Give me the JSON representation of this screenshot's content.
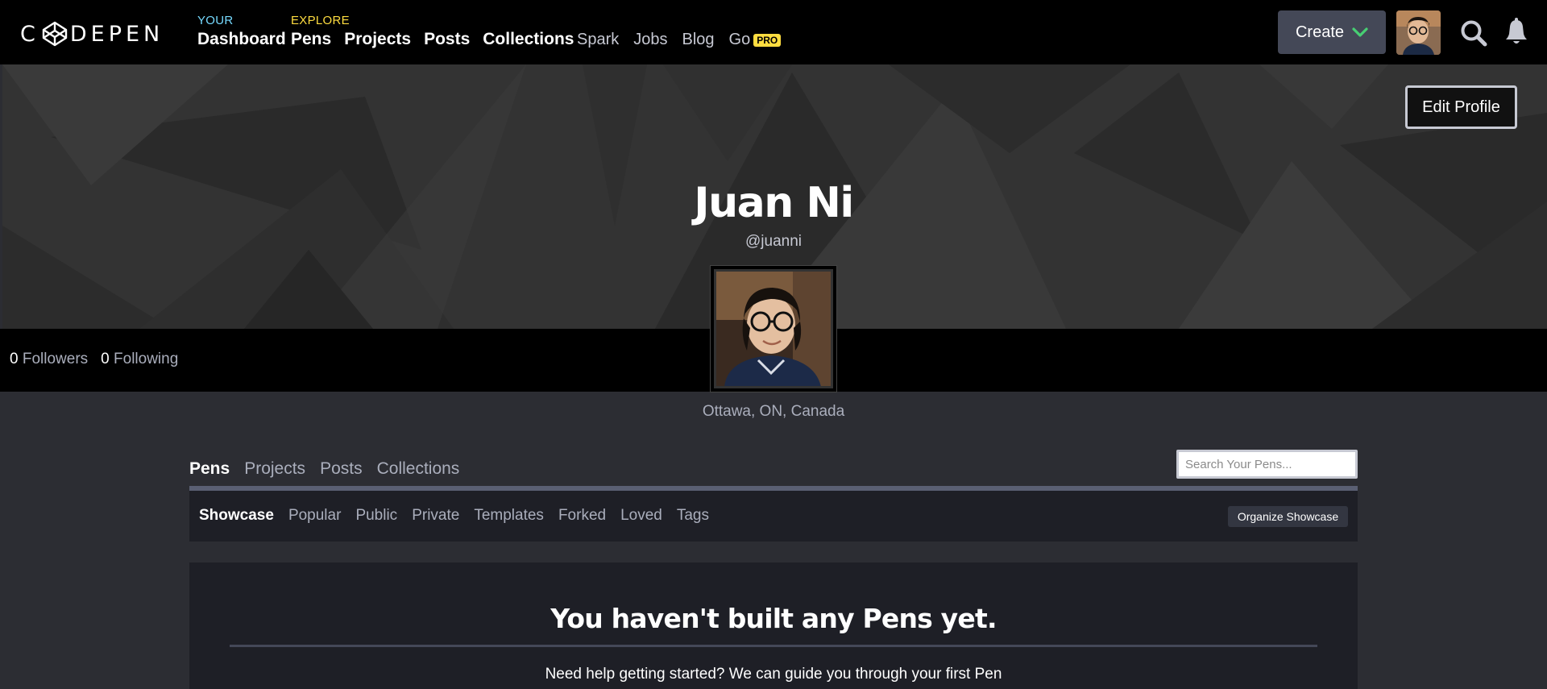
{
  "header": {
    "logo_text_left": "C",
    "logo_text_right": "DEPEN",
    "your_label": "YOUR",
    "your_links": [
      "Dashboard"
    ],
    "explore_label": "EXPLORE",
    "explore_links": [
      "Pens",
      "Projects",
      "Posts",
      "Collections"
    ],
    "secondary_links": [
      "Spark",
      "Jobs",
      "Blog"
    ],
    "go_label": "Go",
    "pro_badge": "PRO",
    "create_label": "Create",
    "icons": [
      "codepen-cube-icon",
      "chevron-down-icon",
      "search-icon",
      "bell-icon"
    ]
  },
  "profile": {
    "edit_label": "Edit Profile",
    "name": "Juan Ni",
    "handle": "@juanni",
    "followers_count": "0",
    "followers_label": "Followers",
    "following_count": "0",
    "following_label": "Following",
    "location": "Ottawa, ON, Canada"
  },
  "tabs": {
    "items": [
      "Pens",
      "Projects",
      "Posts",
      "Collections"
    ],
    "active": "Pens",
    "search_placeholder": "Search Your Pens..."
  },
  "subtabs": {
    "items": [
      "Showcase",
      "Popular",
      "Public",
      "Private",
      "Templates",
      "Forked",
      "Loved",
      "Tags"
    ],
    "active": "Showcase",
    "organize_label": "Organize Showcase"
  },
  "empty_state": {
    "title": "You haven't built any Pens yet.",
    "subtitle": "Need help getting started? We can guide you through your first Pen"
  },
  "colors": {
    "topbar": "#000000",
    "page_bg": "#2c2d33",
    "panel_bg": "#1e1f26",
    "button_bg": "#444857",
    "your_accent": "#76daff",
    "explore_accent": "#ffdd40",
    "create_chevron": "#47cf73"
  }
}
